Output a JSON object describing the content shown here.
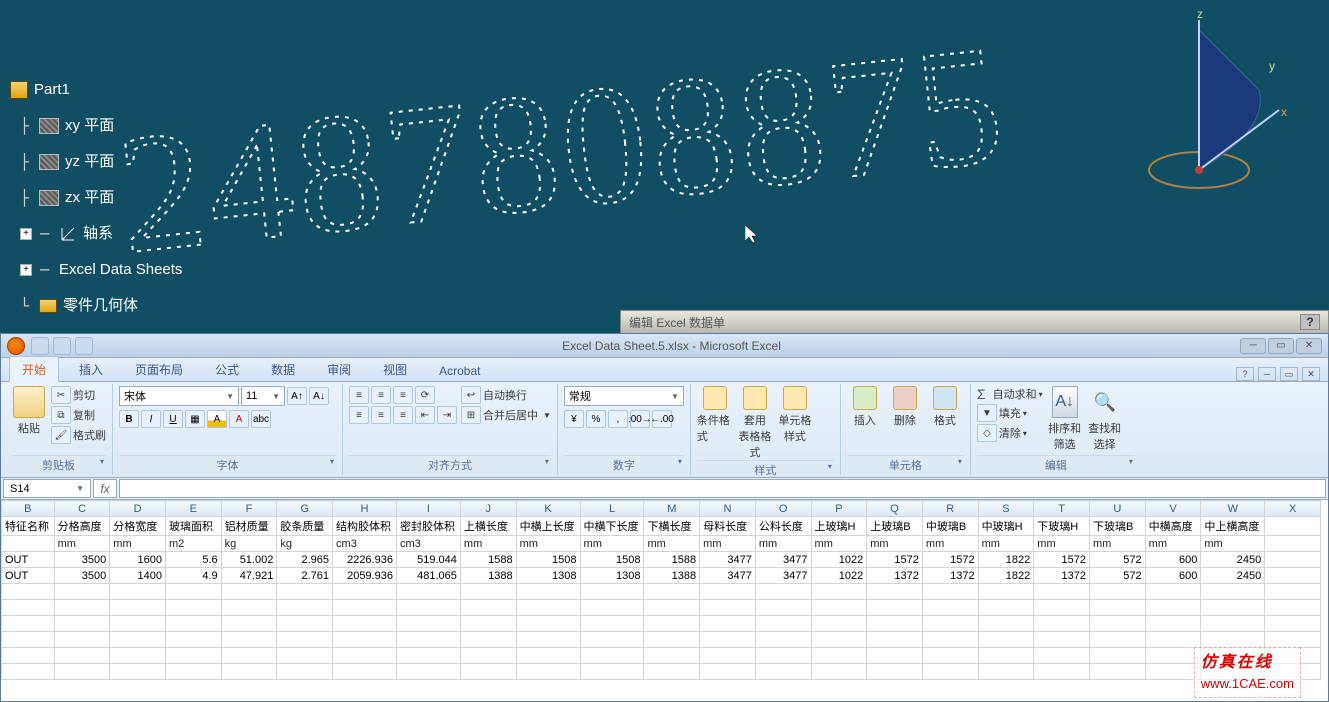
{
  "cad": {
    "tree": {
      "root": "Part1",
      "planes": [
        "xy 平面",
        "yz 平面",
        "zx 平面"
      ],
      "axes": "轴系",
      "excel": "Excel Data Sheets",
      "body": "零件几何体"
    },
    "axes_labels": {
      "x": "x",
      "y": "y",
      "z": "z"
    },
    "sketch_number": "248780887"
  },
  "dialog_title": "编辑 Excel 数据单",
  "excel": {
    "title": "Excel Data Sheet.5.xlsx - Microsoft Excel",
    "tabs": [
      "开始",
      "插入",
      "页面布局",
      "公式",
      "数据",
      "审阅",
      "视图",
      "Acrobat"
    ],
    "active_tab_index": 0,
    "clipboard": {
      "cut": "剪切",
      "copy": "复制",
      "brush": "格式刷",
      "paste": "粘贴",
      "group": "剪贴板"
    },
    "font": {
      "name": "宋体",
      "size": "11",
      "group": "字体",
      "bold": "B",
      "italic": "I",
      "underline": "U"
    },
    "align": {
      "wrap": "自动换行",
      "merge": "合并后居中",
      "group": "对齐方式"
    },
    "number": {
      "format": "常规",
      "group": "数字"
    },
    "styles": {
      "cond": "条件格式",
      "table": "套用\n表格格式",
      "cell": "单元格\n样式",
      "group": "样式"
    },
    "cells": {
      "insert": "插入",
      "delete": "删除",
      "format": "格式",
      "group": "单元格"
    },
    "editing": {
      "sum": "自动求和",
      "fill": "填充",
      "clear": "清除",
      "sort": "排序和\n筛选",
      "find": "查找和\n选择",
      "group": "编辑"
    },
    "name_box": "S14",
    "columns": [
      "B",
      "C",
      "D",
      "E",
      "F",
      "G",
      "H",
      "I",
      "J",
      "K",
      "L",
      "M",
      "N",
      "O",
      "P",
      "Q",
      "R",
      "S",
      "T",
      "U",
      "V",
      "W",
      "X"
    ],
    "header_row": [
      "特征名称",
      "分格高度",
      "分格宽度",
      "玻璃面积",
      "铝材质量",
      "胶条质量",
      "结构胶体积",
      "密封胶体积",
      "上横长度",
      "中横上长度",
      "中横下长度",
      "下横长度",
      "母料长度",
      "公料长度",
      "上玻璃H",
      "上玻璃B",
      "中玻璃B",
      "中玻璃H",
      "下玻璃H",
      "下玻璃B",
      "中横高度",
      "中上横高度",
      ""
    ],
    "unit_row": [
      "",
      "mm",
      "mm",
      "m2",
      "kg",
      "kg",
      "cm3",
      "cm3",
      "mm",
      "mm",
      "mm",
      "mm",
      "mm",
      "mm",
      "mm",
      "mm",
      "mm",
      "mm",
      "mm",
      "mm",
      "mm",
      "mm",
      ""
    ],
    "data_rows": [
      [
        "OUT",
        "3500",
        "1600",
        "5.6",
        "51.002",
        "2.965",
        "2226.936",
        "519.044",
        "1588",
        "1508",
        "1508",
        "1588",
        "3477",
        "3477",
        "1022",
        "1572",
        "1572",
        "1822",
        "1572",
        "572",
        "600",
        "2450",
        ""
      ],
      [
        "OUT",
        "3500",
        "1400",
        "4.9",
        "47.921",
        "2.761",
        "2059.936",
        "481.065",
        "1388",
        "1308",
        "1308",
        "1388",
        "3477",
        "3477",
        "1022",
        "1372",
        "1372",
        "1822",
        "1372",
        "572",
        "600",
        "2450",
        ""
      ]
    ]
  },
  "watermark": {
    "cn": "仿真在线",
    "url": "www.1CAE.com"
  }
}
